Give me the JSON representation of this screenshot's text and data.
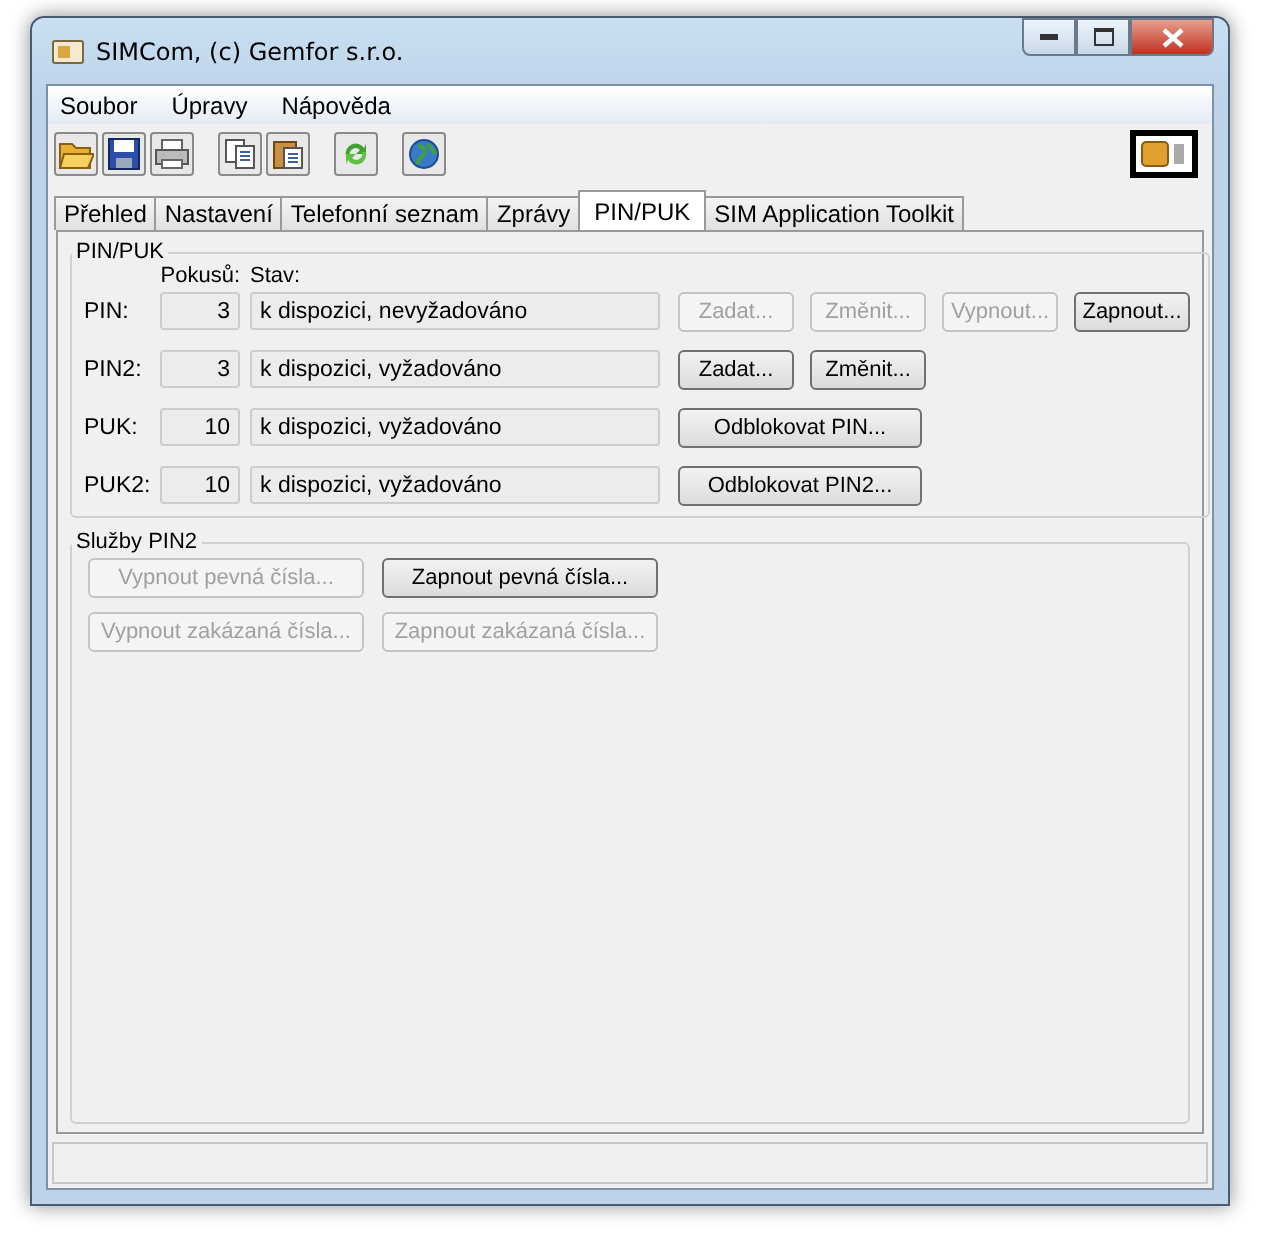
{
  "window": {
    "title": "SIMCom, (c) Gemfor s.r.o."
  },
  "menu": [
    "Soubor",
    "Úpravy",
    "Nápověda"
  ],
  "tabs": [
    {
      "label": "Přehled",
      "selected": false
    },
    {
      "label": "Nastavení",
      "selected": false
    },
    {
      "label": "Telefonní seznam",
      "selected": false
    },
    {
      "label": "Zprávy",
      "selected": false
    },
    {
      "label": "PIN/PUK",
      "selected": true
    },
    {
      "label": "SIM Application Toolkit",
      "selected": false
    }
  ],
  "pin_puk": {
    "title": "PIN/PUK",
    "attempts_header": "Pokusů:",
    "status_header": "Stav:",
    "rows": [
      {
        "label": "PIN:",
        "attempts": "3",
        "status": "k dispozici, nevyžadováno",
        "buttons": [
          {
            "label": "Zadat...",
            "disabled": true,
            "kind": "small"
          },
          {
            "label": "Změnit...",
            "disabled": true,
            "kind": "small"
          },
          {
            "label": "Vypnout...",
            "disabled": true,
            "kind": "small"
          },
          {
            "label": "Zapnout...",
            "disabled": false,
            "kind": "small"
          }
        ]
      },
      {
        "label": "PIN2:",
        "attempts": "3",
        "status": "k dispozici, vyžadováno",
        "buttons": [
          {
            "label": "Zadat...",
            "disabled": false,
            "kind": "small"
          },
          {
            "label": "Změnit...",
            "disabled": false,
            "kind": "small"
          }
        ]
      },
      {
        "label": "PUK:",
        "attempts": "10",
        "status": "k dispozici, vyžadováno",
        "buttons": [
          {
            "label": "Odblokovat PIN...",
            "disabled": false,
            "kind": "wide"
          }
        ]
      },
      {
        "label": "PUK2:",
        "attempts": "10",
        "status": "k dispozici, vyžadováno",
        "buttons": [
          {
            "label": "Odblokovat PIN2...",
            "disabled": false,
            "kind": "wide"
          }
        ]
      }
    ]
  },
  "pin2_services": {
    "title": "Služby PIN2",
    "buttons": [
      {
        "label": "Vypnout pevná čísla...",
        "disabled": true
      },
      {
        "label": "Zapnout pevná čísla...",
        "disabled": false
      },
      {
        "label": "Vypnout zakázaná čísla...",
        "disabled": true
      },
      {
        "label": "Zapnout zakázaná čísla...",
        "disabled": true
      }
    ]
  }
}
